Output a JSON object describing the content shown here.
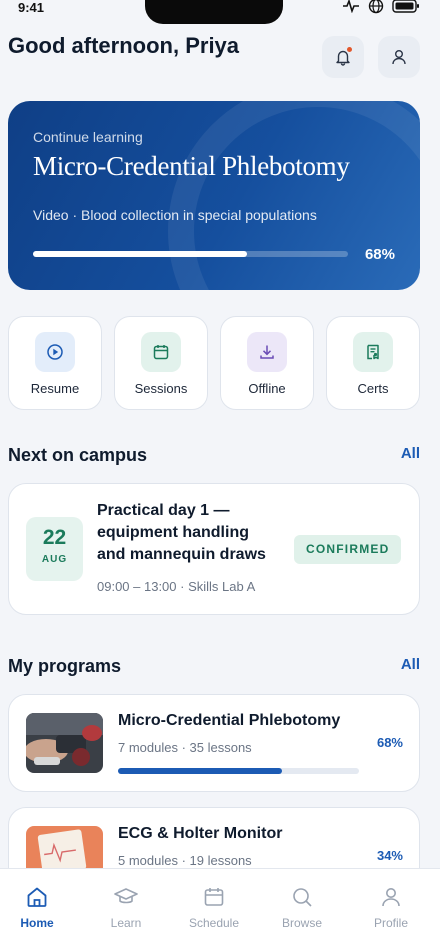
{
  "status": {
    "time": "9:41"
  },
  "header": {
    "greeting": "Good afternoon, Priya",
    "notifications_icon": "bell-icon",
    "profile_icon": "user-icon"
  },
  "hero": {
    "kicker": "Continue learning",
    "title": "Micro-Credential Phlebotomy",
    "subtitle": "Video · Blood collection in special populations",
    "progress": 0.68,
    "progress_label": "68%"
  },
  "quick_actions": [
    {
      "label": "Resume",
      "icon": "play-circle-icon",
      "tint": "#e3edfa",
      "color": "#1c5bb4"
    },
    {
      "label": "Sessions",
      "icon": "calendar-icon",
      "tint": "#e2f2ec",
      "color": "#1b7b5b"
    },
    {
      "label": "Offline",
      "icon": "download-icon",
      "tint": "#ece7f8",
      "color": "#6a4bb5"
    },
    {
      "label": "Certs",
      "icon": "certificate-icon",
      "tint": "#e2f2ec",
      "color": "#1b7b5b"
    }
  ],
  "campus": {
    "title": "Next on campus",
    "link": "All",
    "event": {
      "day": "22",
      "month": "AUG",
      "title": "Practical day 1 — equipment handling and mannequin draws",
      "status": "CONFIRMED",
      "meta": "09:00 – 13:00 · Skills Lab A"
    }
  },
  "programs": {
    "title": "My programs",
    "link": "All",
    "items": [
      {
        "title": "Micro-Credential Phlebotomy",
        "meta": "7 modules · 35 lessons",
        "progress": 0.68,
        "progress_label": "68%"
      },
      {
        "title": "ECG & Holter Monitor",
        "meta": "5 modules · 19 lessons",
        "progress": 0.34,
        "progress_label": "34%"
      }
    ]
  },
  "tabs": [
    {
      "label": "Home",
      "icon": "home-icon",
      "active": true
    },
    {
      "label": "Learn",
      "icon": "graduation-cap-icon",
      "active": false
    },
    {
      "label": "Schedule",
      "icon": "calendar-icon",
      "active": false
    },
    {
      "label": "Browse",
      "icon": "search-icon",
      "active": false
    },
    {
      "label": "Profile",
      "icon": "user-icon",
      "active": false
    }
  ],
  "colors": {
    "accent": "#1c5bb4",
    "success": "#1b7b5b",
    "hero": "#154f9e"
  }
}
